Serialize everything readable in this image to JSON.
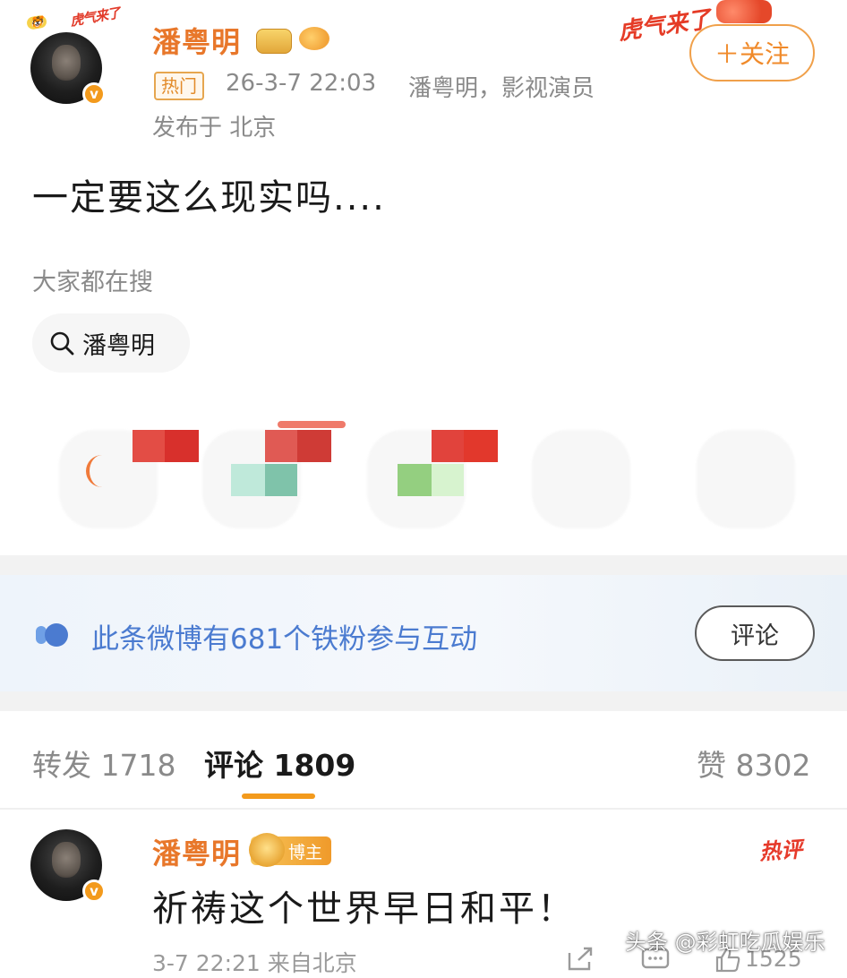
{
  "post": {
    "author_name": "潘粤明",
    "hot_tag": "热门",
    "timestamp": "26-3-7 22:03",
    "author_desc": "潘粤明，影视演员",
    "location": "发布于 北京",
    "follow_label": "＋关注",
    "tiger_sticker": "虎气来了",
    "avatar_sticker": "虎气来了",
    "content": "一定要这么现实吗....",
    "search_hint": "大家都在搜",
    "search_chip": "潘粤明"
  },
  "fans_banner": {
    "text": "此条微博有681个铁粉参与互动",
    "button_label": "评论"
  },
  "tabs": {
    "repost": "转发 1718",
    "comments": "评论 1809",
    "likes": "赞 8302"
  },
  "comment": {
    "author_name": "潘粤明",
    "badge": "博主",
    "hot_label": "热评",
    "text": "祈祷这个世界早日和平！",
    "meta": "3-7 22:21 来自北京",
    "like_count": "1525"
  },
  "watermark": "头条 @彩虹吃瓜娱乐",
  "colors": {
    "accent_orange": "#e8772a",
    "link_blue": "#4b7bd0",
    "hot_red": "#e63a2a"
  }
}
